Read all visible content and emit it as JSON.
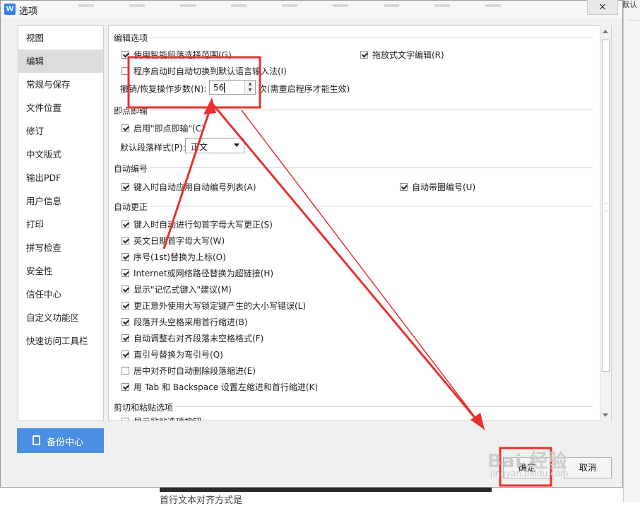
{
  "dialog": {
    "title": "选项",
    "app_icon": "W",
    "close_label": "×",
    "background_corner_text": "默认"
  },
  "sidebar": {
    "items": [
      {
        "label": "视图",
        "active": false
      },
      {
        "label": "编辑",
        "active": true
      },
      {
        "label": "常规与保存",
        "active": false
      },
      {
        "label": "文件位置",
        "active": false
      },
      {
        "label": "修订",
        "active": false
      },
      {
        "label": "中文版式",
        "active": false
      },
      {
        "label": "输出PDF",
        "active": false
      },
      {
        "label": "用户信息",
        "active": false
      },
      {
        "label": "打印",
        "active": false
      },
      {
        "label": "拼写检查",
        "active": false
      },
      {
        "label": "安全性",
        "active": false
      },
      {
        "label": "信任中心",
        "active": false
      },
      {
        "label": "自定义功能区",
        "active": false
      },
      {
        "label": "快速访问工具栏",
        "active": false
      }
    ],
    "backup_label": "备份中心"
  },
  "edit_options": {
    "title": "编辑选项",
    "smart_paragraph": {
      "label": "使用智能段落选择范围(G)",
      "checked": true
    },
    "drag_text": {
      "label": "拖放式文字编辑(R)",
      "checked": true
    },
    "auto_ime": {
      "label": "程序启动时自动切换到默认语言输入法(I)",
      "checked": false
    },
    "undo_steps_label": "撤销/恢复操作步数(N):",
    "undo_steps_value": "56",
    "undo_steps_suffix": "次(需重启程序才能生效)"
  },
  "click_type": {
    "title": "即点即输",
    "enable": {
      "label": "启用\"即点即输\"(C)",
      "checked": true
    },
    "default_style_label": "默认段落样式(P):",
    "default_style_value": "正文"
  },
  "auto_number": {
    "title": "自动编号",
    "auto_list": {
      "label": "键入时自动应用自动编号列表(A)",
      "checked": true
    },
    "circle_number": {
      "label": "自动带圈编号(U)",
      "checked": true
    }
  },
  "auto_correct": {
    "title": "自动更正",
    "items": [
      {
        "label": "键入时自动进行句首字母大写更正(S)",
        "checked": true
      },
      {
        "label": "英文日期首字母大写(W)",
        "checked": true
      },
      {
        "label": "序号(1st)替换为上标(O)",
        "checked": true
      },
      {
        "label": "Internet或网络路径替换为超链接(H)",
        "checked": true
      },
      {
        "label": "显示\"记忆式键入\"建议(M)",
        "checked": true
      },
      {
        "label": "更正意外使用大写锁定键产生的大小写错误(L)",
        "checked": true
      },
      {
        "label": "段落开头空格采用首行缩进(B)",
        "checked": true
      },
      {
        "label": "自动调整右对齐段落末空格格式(F)",
        "checked": true
      },
      {
        "label": "直引号替换为弯引号(Q)",
        "checked": true
      },
      {
        "label": "居中对齐时自动删除段落缩进(E)",
        "checked": false
      },
      {
        "label": "用 Tab 和 Backspace 设置左缩进和首行缩进(K)",
        "checked": true
      }
    ]
  },
  "cut_paste": {
    "title": "剪切和粘贴选项",
    "partial_item": {
      "label": "显示粘贴选项按钮",
      "checked": false
    }
  },
  "footer": {
    "ok_label": "确定",
    "cancel_label": "取消"
  },
  "annotation": {
    "color": "#e8302f",
    "watermark_main": "Bai 经验",
    "watermark_sub": "jingyan.baidu.com"
  },
  "background": {
    "bottom_text": "首行文本对齐方式是"
  }
}
